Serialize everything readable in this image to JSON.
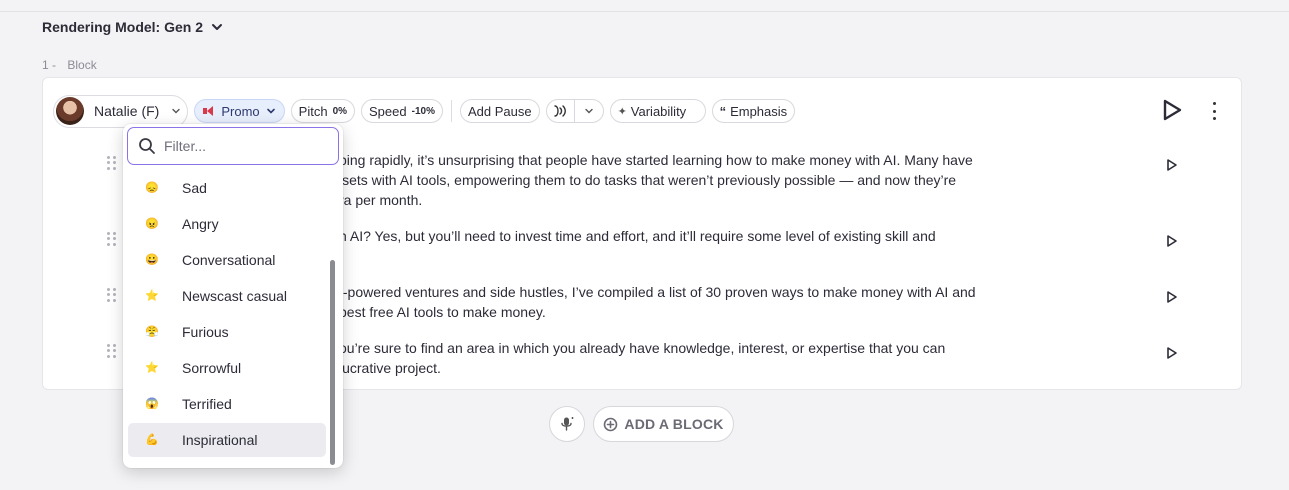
{
  "header": {
    "rendering_model_label": "Rendering Model: Gen 2"
  },
  "block": {
    "index": "1 -",
    "title": "Block"
  },
  "toolbar": {
    "voice_name": "Natalie (F)",
    "style_label": "Promo",
    "pitch_label": "Pitch",
    "pitch_value": "0%",
    "speed_label": "Speed",
    "speed_value": "-10%",
    "add_pause_label": "Add Pause",
    "variability_label": "Variability",
    "emphasis_label": "Emphasis"
  },
  "rows": [
    {
      "lines": [
        "ping rapidly, it’s unsurprising that people have started learning how to make money with AI. Many have",
        "lsets with AI tools, empowering them to do tasks that weren’t previously possible — and now they’re",
        "ra per month."
      ]
    },
    {
      "lines": [
        "h AI? Yes, but you’ll need to invest time and effort, and it’ll require some level of existing skill and"
      ]
    },
    {
      "lines": [
        "I-powered ventures and side hustles, I’ve compiled a list of 30 proven ways to make money with AI and",
        "best free AI tools to make money."
      ]
    },
    {
      "lines": [
        "ou’re sure to find an area in which you already have knowledge, interest, or expertise that you can",
        "lucrative project."
      ]
    }
  ],
  "dropdown": {
    "filter_placeholder": "Filter...",
    "options": [
      {
        "label": "Sad",
        "emoji": "😞",
        "icon": "sad-face-icon",
        "color": "#f3b43c"
      },
      {
        "label": "Angry",
        "emoji": "😠",
        "icon": "angry-face-icon",
        "color": "#f3b43c"
      },
      {
        "label": "Conversational",
        "emoji": "😀",
        "icon": "grinning-face-icon",
        "color": "#f3b43c"
      },
      {
        "label": "Newscast casual",
        "emoji": "⭐",
        "icon": "star-icon",
        "color": "#f3b43c"
      },
      {
        "label": "Furious",
        "emoji": "😤",
        "icon": "furious-face-icon",
        "color": "#f3b43c"
      },
      {
        "label": "Sorrowful",
        "emoji": "⭐",
        "icon": "star-icon",
        "color": "#f3b43c"
      },
      {
        "label": "Terrified",
        "emoji": "😱",
        "icon": "terrified-face-icon",
        "color": "#4a90e2"
      },
      {
        "label": "Inspirational",
        "emoji": "💪",
        "icon": "flexed-arm-icon",
        "color": "#f3b43c"
      }
    ],
    "active_index": 7
  },
  "footer": {
    "add_block_label": "ADD A BLOCK"
  },
  "colors": {
    "accent_focus": "#8b72e8",
    "promo_bg": "#e7eefc",
    "promo_icon": "#d93a4a"
  }
}
